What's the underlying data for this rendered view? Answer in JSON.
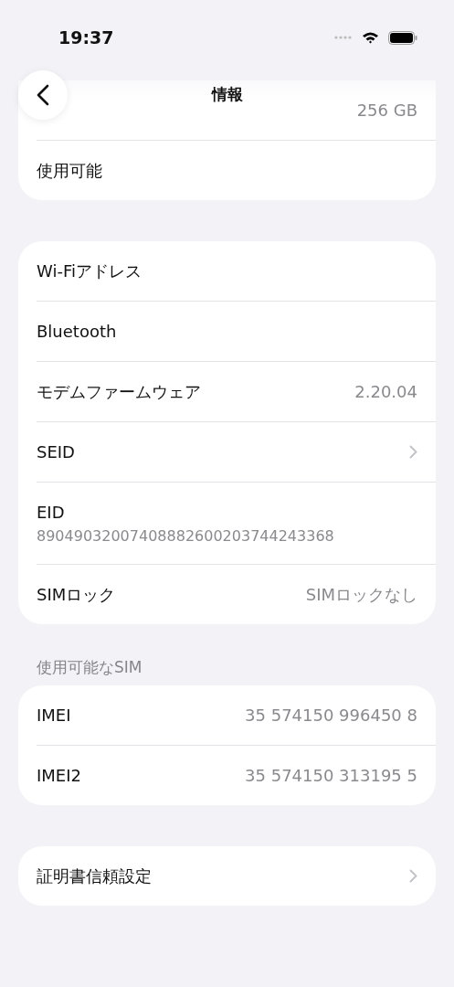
{
  "status_bar": {
    "time": "19:37"
  },
  "nav": {
    "title": "情報"
  },
  "groups": [
    {
      "rows": [
        {
          "kind": "value",
          "label": "",
          "value": "256 GB"
        },
        {
          "kind": "plain",
          "label": "使用可能"
        }
      ]
    },
    {
      "rows": [
        {
          "kind": "plain",
          "label": "Wi-Fiアドレス"
        },
        {
          "kind": "plain",
          "label": "Bluetooth"
        },
        {
          "kind": "value",
          "label": "モデムファームウェア",
          "value": "2.20.04"
        },
        {
          "kind": "chevron",
          "label": "SEID"
        },
        {
          "kind": "detail",
          "label": "EID",
          "value": "89049032007408882600203744243368"
        },
        {
          "kind": "value",
          "label": "SIMロック",
          "value": "SIMロックなし"
        }
      ]
    },
    {
      "header": "使用可能なSIM",
      "rows": [
        {
          "kind": "value",
          "label": "IMEI",
          "value": "35 574150 996450 8"
        },
        {
          "kind": "value",
          "label": "IMEI2",
          "value": "35 574150 313195 5"
        }
      ]
    },
    {
      "rows": [
        {
          "kind": "chevron",
          "label": "証明書信頼設定"
        }
      ]
    }
  ]
}
